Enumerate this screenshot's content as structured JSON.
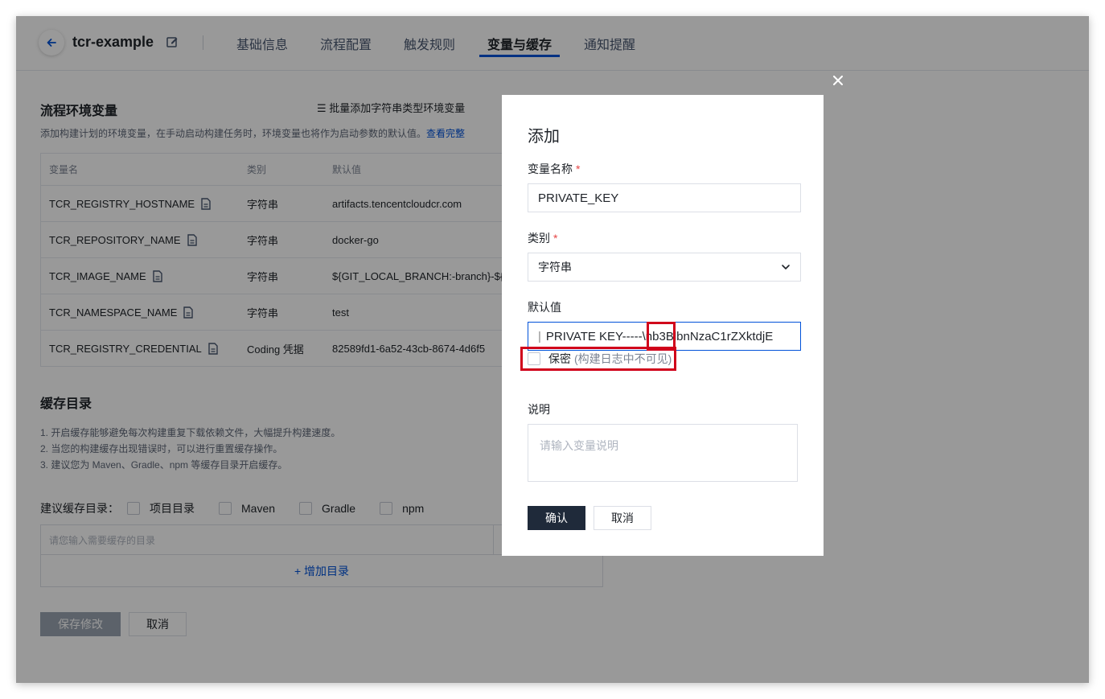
{
  "header": {
    "project_name": "tcr-example",
    "tabs": [
      {
        "label": "基础信息"
      },
      {
        "label": "流程配置"
      },
      {
        "label": "触发规则"
      },
      {
        "label": "变量与缓存"
      },
      {
        "label": "通知提醒"
      }
    ],
    "active_tab": "变量与缓存"
  },
  "env_section": {
    "title": "流程环境变量",
    "description": "添加构建计划的环境变量，在手动启动构建任务时，环境变量也将作为启动参数的默认值。",
    "link_text": "查看完整",
    "batch_add_label": "批量添加字符串类型环境变量"
  },
  "table": {
    "headers": [
      "变量名",
      "类别",
      "默认值"
    ],
    "rows": [
      {
        "name": "TCR_REGISTRY_HOSTNAME",
        "type": "字符串",
        "default": "artifacts.tencentcloudcr.com"
      },
      {
        "name": "TCR_REPOSITORY_NAME",
        "type": "字符串",
        "default": "docker-go"
      },
      {
        "name": "TCR_IMAGE_NAME",
        "type": "字符串",
        "default": "${GIT_LOCAL_BRANCH:-branch}-${"
      },
      {
        "name": "TCR_NAMESPACE_NAME",
        "type": "字符串",
        "default": "test"
      },
      {
        "name": "TCR_REGISTRY_CREDENTIAL",
        "type": "Coding 凭据",
        "default": "82589fd1-6a52-43cb-8674-4d6f5"
      }
    ]
  },
  "cache_section": {
    "title": "缓存目录",
    "tips": [
      "1. 开启缓存能够避免每次构建重复下载依赖文件，大幅提升构建速度。",
      "2. 当您的构建缓存出现错误时，可以进行重置缓存操作。",
      "3. 建议您为 Maven、Gradle、npm 等缓存目录开启缓存。"
    ],
    "suggest_label": "建议缓存目录：",
    "options": [
      "项目目录",
      "Maven",
      "Gradle",
      "npm"
    ],
    "input_placeholder": "请您输入需要缓存的目录",
    "add_dir_label": "+ 增加目录"
  },
  "footer": {
    "save_label": "保存修改",
    "cancel_label": "取消"
  },
  "dialog": {
    "title": "添加",
    "name_label": "变量名称",
    "name_value": "PRIVATE_KEY",
    "type_label": "类别",
    "type_value": "字符串",
    "default_label": "默认值",
    "default_value": "PRIVATE KEY-----\\nb3BlbnNzaC1rZXktdjE",
    "secret_label": "保密",
    "secret_hint": "(构建日志中不可见)",
    "desc_label": "说明",
    "desc_placeholder": "请输入变量说明",
    "confirm_label": "确认",
    "cancel_label": "取消",
    "required_mark": "*"
  },
  "colors": {
    "accent": "#0052d9",
    "highlight": "#d0021b",
    "confirm_bg": "#1f2a3a"
  }
}
